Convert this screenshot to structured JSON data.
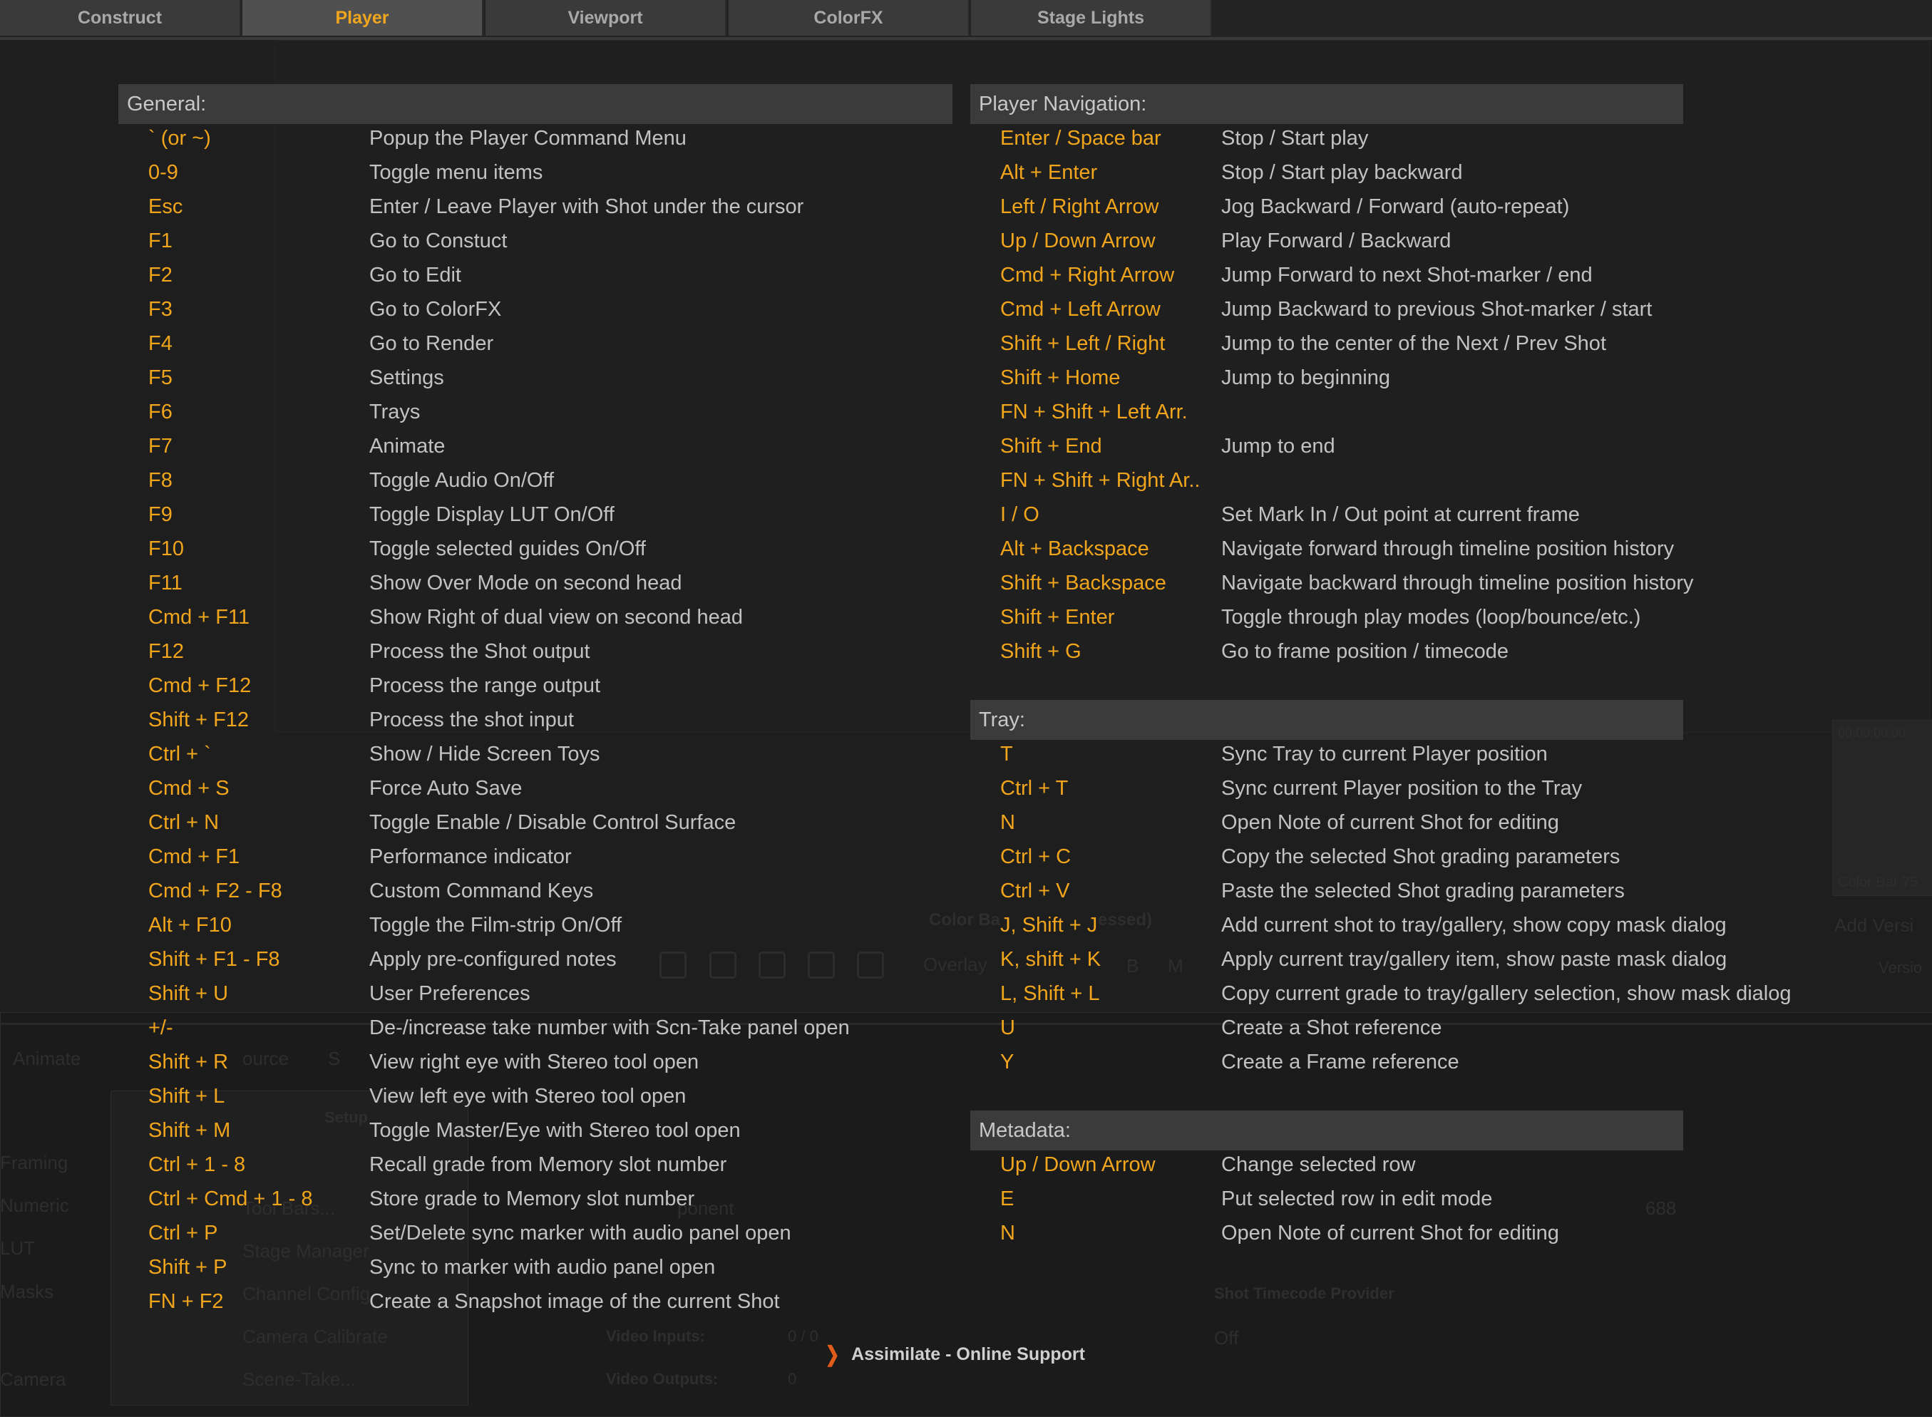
{
  "tabs": [
    {
      "label": "Construct",
      "active": false
    },
    {
      "label": "Player",
      "active": true
    },
    {
      "label": "Viewport",
      "active": false
    },
    {
      "label": "ColorFX",
      "active": false
    },
    {
      "label": "Stage Lights",
      "active": false
    }
  ],
  "background": {
    "color_bar_label": "Color Ba",
    "color_bar_suffix": "essed)",
    "overlay_label": "Overlay",
    "rgb_b": "B",
    "rgb_m": "M",
    "animate": "Animate",
    "source": "ource",
    "s": "S",
    "setup": "Setup",
    "framing": "Framing",
    "numeric": "Numeric",
    "lut": "LUT",
    "masks": "Masks",
    "camera": "Camera",
    "trays_menu": "Tool Bars...",
    "stage_manager": "Stage Manager",
    "channel_config": "Channel Config",
    "camera_calibrate": "Camera Calibrate",
    "scene_take": "Scene-Take...",
    "component": "ponent",
    "video_inputs_label": "Video Inputs:",
    "video_inputs_value": "0 / 0",
    "video_outputs_label": "Video Outputs:",
    "video_outputs_value": "0",
    "timecode_provider": "Shot Timecode Provider",
    "off": "Off",
    "number": "688",
    "timecode": "00:00:00:00",
    "color_bar_75": "Color Bar 75",
    "add_version": "Add Versi",
    "version": "Versio"
  },
  "sections": {
    "general": {
      "title": "General:",
      "rows": [
        {
          "key": "` (or ~)",
          "desc": "Popup the Player Command Menu"
        },
        {
          "key": "0-9",
          "desc": "Toggle menu items"
        },
        {
          "key": "Esc",
          "desc": "Enter / Leave Player with Shot under the cursor"
        },
        {
          "key": "F1",
          "desc": "Go to Constuct"
        },
        {
          "key": "F2",
          "desc": "Go to Edit"
        },
        {
          "key": "F3",
          "desc": "Go to ColorFX"
        },
        {
          "key": "F4",
          "desc": "Go to Render"
        },
        {
          "key": "F5",
          "desc": "Settings"
        },
        {
          "key": "F6",
          "desc": "Trays"
        },
        {
          "key": "F7",
          "desc": "Animate"
        },
        {
          "key": "F8",
          "desc": "Toggle Audio On/Off"
        },
        {
          "key": "F9",
          "desc": "Toggle Display LUT On/Off"
        },
        {
          "key": "F10",
          "desc": "Toggle selected guides On/Off"
        },
        {
          "key": "F11",
          "desc": "Show Over Mode on second head"
        },
        {
          "key": "Cmd + F11",
          "desc": "Show Right of dual view on second head"
        },
        {
          "key": "F12",
          "desc": "Process the Shot output"
        },
        {
          "key": "Cmd + F12",
          "desc": "Process the range output"
        },
        {
          "key": "Shift + F12",
          "desc": "Process the shot input"
        },
        {
          "key": "Ctrl + `",
          "desc": "Show / Hide Screen Toys"
        },
        {
          "key": "Cmd + S",
          "desc": "Force Auto Save"
        },
        {
          "key": "Ctrl + N",
          "desc": "Toggle Enable / Disable Control Surface"
        },
        {
          "key": "Cmd + F1",
          "desc": "Performance indicator"
        },
        {
          "key": "Cmd + F2 - F8",
          "desc": "Custom Command Keys"
        },
        {
          "key": "Alt + F10",
          "desc": "Toggle the Film-strip On/Off"
        },
        {
          "key": "Shift + F1 - F8",
          "desc": "Apply pre-configured notes"
        },
        {
          "key": "Shift + U",
          "desc": "User Preferences"
        },
        {
          "key": "+/-",
          "desc": "De-/increase take number with Scn-Take panel open"
        },
        {
          "key": "Shift + R",
          "desc": "View right eye with Stereo tool open"
        },
        {
          "key": "Shift + L",
          "desc": "View left eye with Stereo tool open"
        },
        {
          "key": "Shift + M",
          "desc": "Toggle Master/Eye with Stereo tool open"
        },
        {
          "key": "Ctrl + 1 - 8",
          "desc": "Recall grade from Memory slot number"
        },
        {
          "key": "Ctrl + Cmd + 1 - 8",
          "desc": "Store grade to Memory slot number"
        },
        {
          "key": "Ctrl + P",
          "desc": "Set/Delete sync marker with audio panel open"
        },
        {
          "key": "Shift + P",
          "desc": "Sync to marker with audio panel open"
        },
        {
          "key": "FN + F2",
          "desc": "Create a Snapshot image of the current Shot"
        }
      ]
    },
    "player_navigation": {
      "title": "Player Navigation:",
      "rows": [
        {
          "key": "Enter / Space bar",
          "desc": "Stop / Start play"
        },
        {
          "key": "Alt + Enter",
          "desc": "Stop / Start play backward"
        },
        {
          "key": "Left / Right Arrow",
          "desc": "Jog Backward / Forward (auto-repeat)"
        },
        {
          "key": "Up / Down Arrow",
          "desc": "Play Forward / Backward"
        },
        {
          "key": "Cmd + Right Arrow",
          "desc": "Jump Forward to next Shot-marker / end"
        },
        {
          "key": "Cmd + Left Arrow",
          "desc": "Jump Backward to previous Shot-marker / start"
        },
        {
          "key": "Shift + Left / Right",
          "desc": "Jump to the center of the Next / Prev Shot"
        },
        {
          "key": "Shift + Home",
          "desc": "Jump to beginning"
        },
        {
          "key": "FN + Shift + Left Arr.",
          "desc": ""
        },
        {
          "key": "Shift + End",
          "desc": "Jump to end"
        },
        {
          "key": "FN + Shift + Right Ar..",
          "desc": ""
        },
        {
          "key": "I / O",
          "desc": "Set Mark In / Out point at current frame"
        },
        {
          "key": "Alt + Backspace",
          "desc": "Navigate forward through timeline position history"
        },
        {
          "key": "Shift + Backspace",
          "desc": "Navigate backward through timeline position history"
        },
        {
          "key": "Shift + Enter",
          "desc": "Toggle through play modes (loop/bounce/etc.)"
        },
        {
          "key": "Shift + G",
          "desc": "Go to frame position / timecode"
        }
      ]
    },
    "tray": {
      "title": "Tray:",
      "rows": [
        {
          "key": "T",
          "desc": "Sync Tray to current Player position"
        },
        {
          "key": "Ctrl + T",
          "desc": "Sync current Player position to the Tray"
        },
        {
          "key": "N",
          "desc": "Open Note of current Shot for editing"
        },
        {
          "key": "Ctrl + C",
          "desc": "Copy the selected Shot grading parameters"
        },
        {
          "key": "Ctrl + V",
          "desc": "Paste the selected Shot grading parameters"
        },
        {
          "key": "J, Shift + J",
          "desc": "Add current shot to tray/gallery, show copy mask dialog"
        },
        {
          "key": "K, shift + K",
          "desc": "Apply current tray/gallery item, show paste mask dialog"
        },
        {
          "key": "L, Shift + L",
          "desc": "Copy current grade to tray/gallery selection, show mask dialog"
        },
        {
          "key": "U",
          "desc": "Create a Shot reference"
        },
        {
          "key": "Y",
          "desc": "Create a Frame reference"
        }
      ]
    },
    "metadata": {
      "title": "Metadata:",
      "rows": [
        {
          "key": "Up / Down Arrow",
          "desc": "Change selected row"
        },
        {
          "key": "E",
          "desc": "Put selected row in edit mode"
        },
        {
          "key": "N",
          "desc": "Open Note of current Shot for editing"
        }
      ]
    }
  },
  "footer": {
    "support_link": "Assimilate - Online Support"
  },
  "colors": {
    "accent": "#f0a51c",
    "header_bg": "#3b3b3b",
    "support_chevron": "#e25d1b"
  }
}
